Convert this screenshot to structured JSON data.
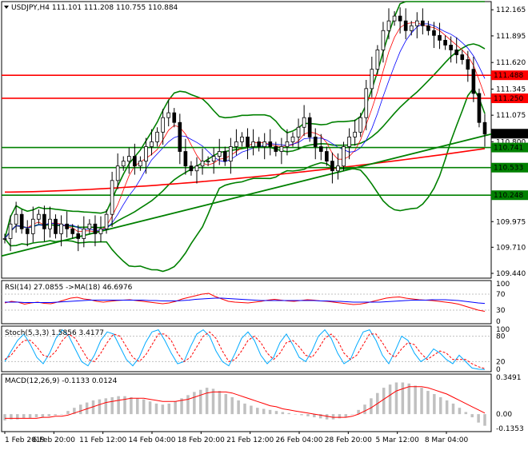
{
  "chart_data": [
    {
      "type": "candlestick",
      "title": "USDJPY,H4  111.101 111.208 110.755 110.884",
      "symbol": "USDJPY",
      "timeframe": "H4",
      "ohlc_last": [
        111.101,
        111.208,
        110.755,
        110.884
      ],
      "y_ticks": [
        "112.165",
        "111.895",
        "111.620",
        "111.345",
        "111.075",
        "110.800",
        "110.525",
        "110.250",
        "109.975",
        "109.710",
        "109.440"
      ],
      "ylim": [
        109.44,
        112.2
      ],
      "current_price_label": "110.884",
      "horizontal_lines": [
        {
          "value": 111.488,
          "label": "111.488",
          "color": "#ff0000"
        },
        {
          "value": 111.25,
          "label": "111.250",
          "color": "#ff0000"
        },
        {
          "value": 110.741,
          "label": "110.741",
          "color": "#008000"
        },
        {
          "value": 110.533,
          "label": "110.533",
          "color": "#008000"
        },
        {
          "value": 110.248,
          "label": "110.248",
          "color": "#008000"
        }
      ],
      "close_series": [
        109.8,
        109.95,
        110.05,
        109.9,
        109.85,
        110.0,
        110.05,
        109.9,
        110.0,
        109.85,
        109.95,
        109.9,
        109.85,
        109.8,
        109.9,
        109.95,
        109.85,
        109.9,
        110.05,
        110.4,
        110.55,
        110.6,
        110.65,
        110.55,
        110.6,
        110.75,
        110.8,
        110.9,
        111.05,
        111.1,
        111.0,
        110.7,
        110.55,
        110.5,
        110.55,
        110.6,
        110.6,
        110.65,
        110.7,
        110.6,
        110.75,
        110.8,
        110.85,
        110.75,
        110.8,
        110.75,
        110.8,
        110.75,
        110.7,
        110.75,
        110.8,
        110.85,
        110.95,
        111.05,
        110.85,
        110.75,
        110.7,
        110.6,
        110.5,
        110.55,
        110.75,
        110.85,
        110.9,
        111.05,
        111.35,
        111.55,
        111.75,
        111.95,
        112.05,
        112.1,
        112.05,
        111.95,
        112.0,
        112.05,
        112.0,
        111.95,
        111.9,
        111.85,
        111.8,
        111.75,
        111.7,
        111.65,
        111.55,
        111.3,
        111.0,
        110.88
      ],
      "colors": {
        "bollinger": "#008000",
        "ma_fast": "#ff0000",
        "ma_slow": "#0000ff",
        "ma_long": "#ff0000",
        "trendline": "#008000",
        "candles": "#000000"
      }
    },
    {
      "type": "line",
      "title": "RSI(14) 27.0855  ->MA(18) 46.6976",
      "y_ticks": [
        "100",
        "70",
        "30",
        "0"
      ],
      "ylim": [
        0,
        100
      ],
      "series": [
        {
          "name": "RSI(14)",
          "color": "#ff0000",
          "values": [
            48,
            52,
            50,
            45,
            48,
            50,
            47,
            46,
            50,
            55,
            60,
            62,
            58,
            56,
            52,
            50,
            52,
            54,
            55,
            56,
            54,
            52,
            50,
            48,
            46,
            48,
            52,
            58,
            62,
            66,
            70,
            72,
            64,
            58,
            52,
            50,
            49,
            48,
            50,
            52,
            55,
            57,
            55,
            53,
            52,
            54,
            56,
            55,
            53,
            52,
            50,
            48,
            46,
            44,
            45,
            48,
            52,
            56,
            60,
            62,
            63,
            60,
            58,
            56,
            55,
            54,
            52,
            50,
            48,
            45,
            40,
            35,
            30,
            27
          ]
        },
        {
          "name": "MA(18)",
          "color": "#0000ff",
          "values": [
            50,
            50,
            50,
            49,
            49,
            49,
            49,
            49,
            50,
            51,
            52,
            53,
            54,
            55,
            55,
            55,
            55,
            55,
            55,
            55,
            55,
            55,
            54,
            54,
            53,
            53,
            53,
            54,
            55,
            57,
            58,
            59,
            60,
            60,
            59,
            58,
            57,
            56,
            55,
            54,
            54,
            54,
            54,
            54,
            54,
            54,
            54,
            54,
            53,
            53,
            52,
            52,
            51,
            50,
            50,
            50,
            50,
            50,
            51,
            52,
            53,
            54,
            55,
            55,
            55,
            56,
            56,
            56,
            55,
            54,
            52,
            50,
            48,
            46.7
          ]
        }
      ]
    },
    {
      "type": "line",
      "title": "Stoch(5,3,3) 1.5856 3.4177",
      "y_ticks": [
        "100",
        "80",
        "20",
        "0"
      ],
      "ylim": [
        0,
        100
      ],
      "series": [
        {
          "name": "%K",
          "color": "#00aaff",
          "values": [
            20,
            45,
            70,
            85,
            60,
            30,
            15,
            40,
            75,
            95,
            80,
            50,
            20,
            10,
            35,
            70,
            90,
            85,
            55,
            25,
            10,
            30,
            65,
            90,
            95,
            70,
            40,
            15,
            20,
            55,
            85,
            95,
            80,
            45,
            20,
            10,
            40,
            75,
            90,
            70,
            35,
            15,
            30,
            65,
            85,
            60,
            30,
            20,
            45,
            80,
            95,
            75,
            40,
            15,
            25,
            60,
            90,
            95,
            70,
            35,
            15,
            45,
            80,
            70,
            40,
            20,
            30,
            50,
            40,
            25,
            15,
            35,
            20,
            5,
            2,
            1.6
          ]
        },
        {
          "name": "%D",
          "color": "#ff0000",
          "values": [
            25,
            35,
            55,
            70,
            70,
            55,
            35,
            30,
            45,
            70,
            85,
            75,
            50,
            25,
            20,
            40,
            65,
            85,
            80,
            55,
            30,
            20,
            35,
            60,
            85,
            85,
            70,
            40,
            20,
            30,
            55,
            80,
            90,
            75,
            45,
            20,
            25,
            45,
            70,
            80,
            65,
            40,
            25,
            40,
            65,
            70,
            55,
            35,
            30,
            50,
            75,
            85,
            70,
            40,
            25,
            35,
            60,
            85,
            85,
            65,
            40,
            30,
            50,
            65,
            60,
            40,
            25,
            35,
            45,
            40,
            25,
            25,
            25,
            15,
            8,
            3.4
          ]
        }
      ]
    },
    {
      "type": "bar",
      "title": "MACD(12,26,9) -0.1133 0.0124",
      "y_ticks": [
        "0.3491",
        "0.00",
        "-0.1353"
      ],
      "ylim": [
        -0.1353,
        0.3491
      ],
      "series": [
        {
          "name": "MACD",
          "color": "#c0c0c0",
          "values": [
            -0.06,
            -0.05,
            -0.05,
            -0.04,
            -0.04,
            -0.03,
            -0.03,
            -0.02,
            -0.01,
            0.0,
            0.03,
            0.06,
            0.09,
            0.11,
            0.13,
            0.14,
            0.15,
            0.16,
            0.17,
            0.17,
            0.16,
            0.15,
            0.14,
            0.12,
            0.1,
            0.09,
            0.1,
            0.12,
            0.15,
            0.18,
            0.21,
            0.23,
            0.25,
            0.24,
            0.22,
            0.19,
            0.16,
            0.13,
            0.1,
            0.08,
            0.06,
            0.05,
            0.04,
            0.03,
            0.02,
            0.01,
            0.0,
            -0.01,
            -0.02,
            -0.03,
            -0.04,
            -0.05,
            -0.05,
            -0.04,
            -0.03,
            0.0,
            0.04,
            0.09,
            0.15,
            0.2,
            0.25,
            0.28,
            0.3,
            0.3,
            0.29,
            0.27,
            0.25,
            0.22,
            0.19,
            0.16,
            0.13,
            0.1,
            0.06,
            0.02,
            -0.03,
            -0.08,
            -0.11
          ]
        },
        {
          "name": "Signal",
          "color": "#ff0000",
          "values": [
            -0.04,
            -0.04,
            -0.04,
            -0.04,
            -0.04,
            -0.04,
            -0.03,
            -0.03,
            -0.02,
            -0.02,
            -0.01,
            0.01,
            0.03,
            0.05,
            0.07,
            0.09,
            0.11,
            0.12,
            0.13,
            0.14,
            0.15,
            0.15,
            0.15,
            0.14,
            0.13,
            0.12,
            0.12,
            0.12,
            0.13,
            0.14,
            0.16,
            0.18,
            0.2,
            0.21,
            0.21,
            0.21,
            0.2,
            0.18,
            0.16,
            0.14,
            0.12,
            0.1,
            0.08,
            0.07,
            0.05,
            0.04,
            0.03,
            0.02,
            0.01,
            0.0,
            -0.01,
            -0.02,
            -0.03,
            -0.03,
            -0.03,
            -0.02,
            0.0,
            0.03,
            0.06,
            0.1,
            0.14,
            0.18,
            0.22,
            0.24,
            0.26,
            0.26,
            0.26,
            0.25,
            0.23,
            0.21,
            0.19,
            0.16,
            0.13,
            0.1,
            0.07,
            0.04,
            0.01
          ]
        }
      ]
    }
  ],
  "x_axis_labels": [
    "1 Feb 2019",
    "6 Feb 20:00",
    "11 Feb 12:00",
    "14 Feb 04:00",
    "18 Feb 20:00",
    "21 Feb 12:00",
    "26 Feb 04:00",
    "28 Feb 20:00",
    "5 Mar 12:00",
    "8 Mar 04:00"
  ]
}
